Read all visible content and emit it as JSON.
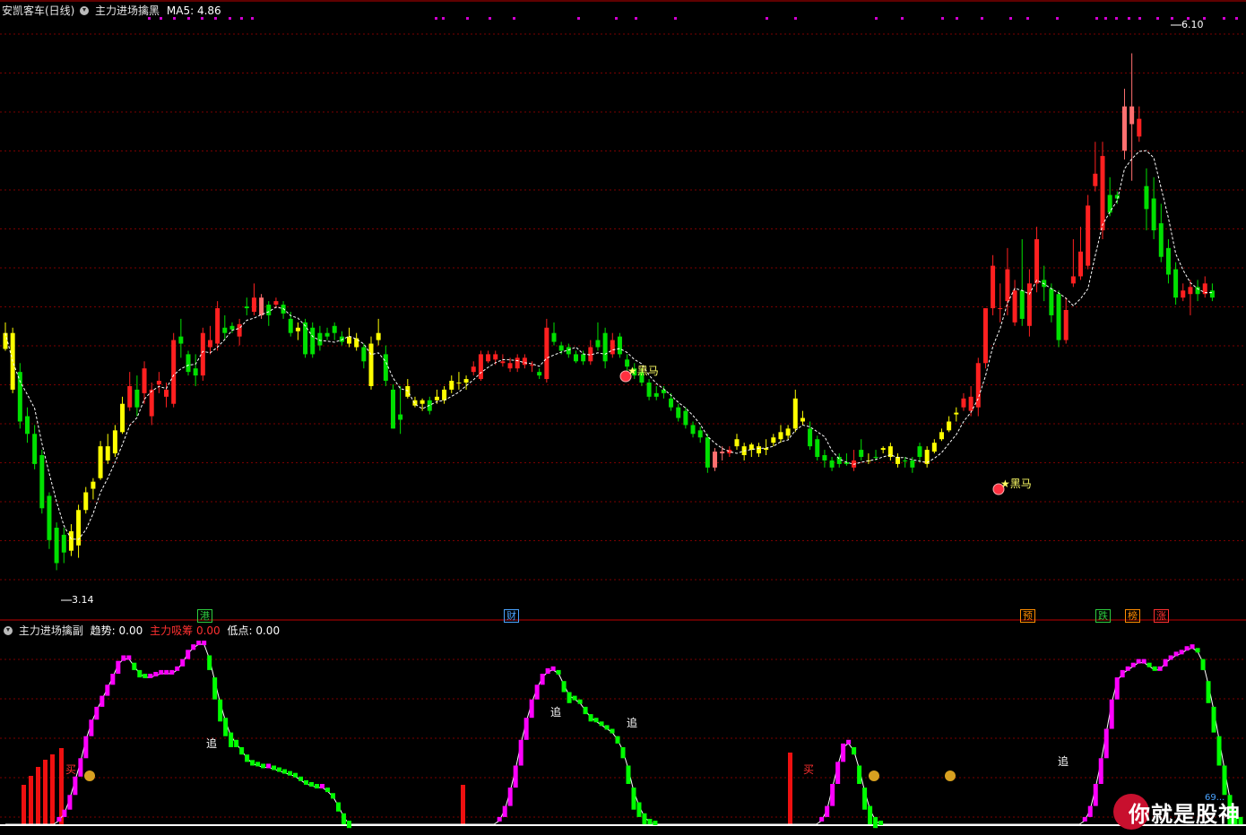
{
  "header": {
    "stock_name": "安凯客车(日线)",
    "indicator_name": "主力进场擒黑",
    "ma_label": "MA5:",
    "ma_value": "4.86"
  },
  "sub_header": {
    "indicator_name": "主力进场擒副",
    "trend_label": "趋势:",
    "trend_value": "0.00",
    "absorb_label": "主力吸筹",
    "absorb_value": "0.00",
    "low_label": "低点:",
    "low_value": "0.00"
  },
  "price_labels": {
    "high": "6.10",
    "low": "3.14"
  },
  "signals": {
    "dark_horse": "黑马",
    "buy": "买",
    "chase": "追"
  },
  "event_tags": [
    {
      "text": "港",
      "color": "#2ecc40"
    },
    {
      "text": "财",
      "color": "#4aa3ff"
    },
    {
      "text": "预",
      "color": "#ff8c00"
    },
    {
      "text": "跌",
      "color": "#2ecc40"
    },
    {
      "text": "榜",
      "color": "#ff8c00"
    },
    {
      "text": "涨",
      "color": "#ff3030"
    }
  ],
  "watermark": {
    "text": "你就是股神",
    "small": "69..."
  },
  "colors": {
    "up": "#ff2020",
    "down": "#00e000",
    "yellow": "#ffff00",
    "ma": "#ffffff",
    "trend_up": "#ff00ff",
    "trend_down": "#00ff00",
    "grid": "#7a0000",
    "axis": "#c00000",
    "dots": "#d000d0"
  },
  "chart_data": {
    "type": "candlestick",
    "ylim": [
      3.0,
      6.3
    ],
    "candles": [
      [
        4.43,
        4.52,
        4.58,
        4.42,
        "y"
      ],
      [
        4.52,
        4.2,
        4.55,
        4.18,
        "y"
      ],
      [
        4.3,
        4.02,
        4.35,
        3.98,
        "d"
      ],
      [
        4.05,
        3.95,
        4.1,
        3.9,
        "d"
      ],
      [
        3.95,
        3.78,
        4.0,
        3.75,
        "d"
      ],
      [
        3.83,
        3.53,
        3.86,
        3.5,
        "d"
      ],
      [
        3.6,
        3.35,
        3.62,
        3.3,
        "d"
      ],
      [
        3.42,
        3.22,
        3.45,
        3.18,
        "d"
      ],
      [
        3.38,
        3.28,
        3.42,
        3.22,
        "d"
      ],
      [
        3.29,
        3.4,
        3.44,
        3.26,
        "y"
      ],
      [
        3.32,
        3.52,
        3.55,
        3.25,
        "y"
      ],
      [
        3.52,
        3.62,
        3.65,
        3.5,
        "y"
      ],
      [
        3.64,
        3.68,
        3.7,
        3.58,
        "y"
      ],
      [
        3.7,
        3.88,
        3.91,
        3.69,
        "y"
      ],
      [
        3.88,
        3.8,
        3.95,
        3.78,
        "y"
      ],
      [
        3.84,
        3.97,
        4.0,
        3.82,
        "y"
      ],
      [
        3.96,
        4.12,
        4.16,
        3.95,
        "y"
      ],
      [
        4.1,
        4.22,
        4.3,
        4.08,
        "u"
      ],
      [
        4.2,
        4.1,
        4.28,
        4.05,
        "d"
      ],
      [
        4.18,
        4.32,
        4.36,
        4.12,
        "u"
      ],
      [
        4.05,
        4.2,
        4.24,
        4.0,
        "u"
      ],
      [
        4.23,
        4.25,
        4.3,
        4.18,
        "u"
      ],
      [
        4.2,
        4.16,
        4.24,
        4.1,
        "u"
      ],
      [
        4.12,
        4.48,
        4.52,
        4.1,
        "u"
      ],
      [
        4.46,
        4.5,
        4.6,
        4.38,
        "d"
      ],
      [
        4.4,
        4.3,
        4.42,
        4.28,
        "d"
      ],
      [
        4.32,
        4.28,
        4.4,
        4.22,
        "d"
      ],
      [
        4.28,
        4.52,
        4.55,
        4.25,
        "u"
      ],
      [
        4.48,
        4.44,
        4.56,
        4.4,
        "u"
      ],
      [
        4.46,
        4.66,
        4.7,
        4.42,
        "u"
      ],
      [
        4.55,
        4.52,
        4.62,
        4.48,
        "d"
      ],
      [
        4.56,
        4.54,
        4.58,
        4.52,
        "d"
      ],
      [
        4.5,
        4.57,
        4.6,
        4.45,
        "u"
      ],
      [
        4.66,
        4.67,
        4.72,
        4.62,
        "d"
      ],
      [
        4.64,
        4.72,
        4.8,
        4.62,
        "u"
      ],
      [
        4.72,
        4.62,
        4.74,
        4.6,
        "r"
      ],
      [
        4.68,
        4.62,
        4.7,
        4.56,
        "d"
      ],
      [
        4.68,
        4.7,
        4.72,
        4.66,
        "u"
      ],
      [
        4.68,
        4.63,
        4.7,
        4.6,
        "d"
      ],
      [
        4.6,
        4.52,
        4.64,
        4.5,
        "d"
      ],
      [
        4.53,
        4.55,
        4.58,
        4.48,
        "y"
      ],
      [
        4.58,
        4.4,
        4.6,
        4.38,
        "d"
      ],
      [
        4.55,
        4.4,
        4.58,
        4.38,
        "d"
      ],
      [
        4.45,
        4.52,
        4.56,
        4.42,
        "d"
      ],
      [
        4.52,
        4.5,
        4.55,
        4.48,
        "d"
      ],
      [
        4.56,
        4.52,
        4.58,
        4.48,
        "d"
      ],
      [
        4.5,
        4.47,
        4.53,
        4.45,
        "d"
      ],
      [
        4.46,
        4.5,
        4.55,
        4.44,
        "y"
      ],
      [
        4.49,
        4.44,
        4.52,
        4.42,
        "y"
      ],
      [
        4.44,
        4.36,
        4.46,
        4.32,
        "d"
      ],
      [
        4.46,
        4.22,
        4.5,
        4.2,
        "y"
      ],
      [
        4.48,
        4.52,
        4.6,
        4.45,
        "y"
      ],
      [
        4.4,
        4.25,
        4.45,
        4.22,
        "d"
      ],
      [
        4.2,
        3.98,
        4.23,
        3.98,
        "d"
      ],
      [
        4.03,
        4.06,
        4.22,
        3.95,
        "d"
      ],
      [
        4.22,
        4.16,
        4.26,
        4.15,
        "y"
      ],
      [
        4.11,
        4.14,
        4.16,
        4.1,
        "y"
      ],
      [
        4.14,
        4.12,
        4.15,
        4.08,
        "y"
      ],
      [
        4.14,
        4.08,
        4.16,
        4.06,
        "d"
      ],
      [
        4.14,
        4.16,
        4.2,
        4.12,
        "y"
      ],
      [
        4.14,
        4.2,
        4.22,
        4.12,
        "y"
      ],
      [
        4.2,
        4.25,
        4.28,
        4.18,
        "y"
      ],
      [
        4.24,
        4.24,
        4.3,
        4.2,
        "y"
      ],
      [
        4.24,
        4.26,
        4.28,
        4.2,
        "y"
      ],
      [
        4.3,
        4.33,
        4.36,
        4.28,
        "u"
      ],
      [
        4.26,
        4.4,
        4.42,
        4.25,
        "u"
      ],
      [
        4.36,
        4.4,
        4.42,
        4.35,
        "u"
      ],
      [
        4.4,
        4.37,
        4.42,
        4.34,
        "u"
      ],
      [
        4.36,
        4.35,
        4.4,
        4.33,
        "u"
      ],
      [
        4.35,
        4.32,
        4.38,
        4.3,
        "u"
      ],
      [
        4.32,
        4.38,
        4.4,
        4.3,
        "u"
      ],
      [
        4.38,
        4.34,
        4.4,
        4.32,
        "u"
      ],
      [
        4.34,
        4.34,
        4.36,
        4.3,
        "u"
      ],
      [
        4.3,
        4.28,
        4.32,
        4.26,
        "d"
      ],
      [
        4.26,
        4.55,
        4.6,
        4.24,
        "u"
      ],
      [
        4.52,
        4.47,
        4.58,
        4.45,
        "d"
      ],
      [
        4.45,
        4.42,
        4.47,
        4.4,
        "d"
      ],
      [
        4.44,
        4.4,
        4.46,
        4.38,
        "d"
      ],
      [
        4.4,
        4.36,
        4.42,
        4.35,
        "d"
      ],
      [
        4.4,
        4.36,
        4.42,
        4.34,
        "d"
      ],
      [
        4.36,
        4.44,
        4.48,
        4.34,
        "u"
      ],
      [
        4.44,
        4.48,
        4.58,
        4.42,
        "d"
      ],
      [
        4.52,
        4.36,
        4.55,
        4.32,
        "d"
      ],
      [
        4.4,
        4.48,
        4.52,
        4.38,
        "u"
      ],
      [
        4.5,
        4.4,
        4.52,
        4.38,
        "d"
      ],
      [
        4.37,
        4.33,
        4.4,
        4.3,
        "d"
      ],
      [
        4.32,
        4.28,
        4.35,
        4.26,
        "d"
      ],
      [
        4.3,
        4.24,
        4.32,
        4.22,
        "d"
      ],
      [
        4.24,
        4.16,
        4.26,
        4.14,
        "d"
      ],
      [
        4.18,
        4.16,
        4.22,
        4.14,
        "d"
      ],
      [
        4.2,
        4.18,
        4.22,
        4.15,
        "d"
      ],
      [
        4.15,
        4.1,
        4.18,
        4.08,
        "d"
      ],
      [
        4.1,
        4.04,
        4.12,
        4.02,
        "d"
      ],
      [
        4.08,
        4.0,
        4.1,
        3.98,
        "d"
      ],
      [
        4.0,
        3.95,
        4.02,
        3.93,
        "d"
      ],
      [
        3.97,
        3.93,
        3.99,
        3.9,
        "d"
      ],
      [
        3.93,
        3.76,
        3.95,
        3.73,
        "d"
      ],
      [
        3.76,
        3.85,
        3.87,
        3.74,
        "r"
      ],
      [
        3.84,
        3.85,
        3.88,
        3.8,
        "r"
      ],
      [
        3.84,
        3.86,
        3.88,
        3.82,
        "u"
      ],
      [
        3.92,
        3.88,
        3.95,
        3.86,
        "y"
      ],
      [
        3.88,
        3.83,
        3.9,
        3.8,
        "y"
      ],
      [
        3.86,
        3.89,
        3.9,
        3.82,
        "y"
      ],
      [
        3.84,
        3.88,
        3.9,
        3.82,
        "y"
      ],
      [
        3.86,
        3.87,
        3.92,
        3.83,
        "y"
      ],
      [
        3.9,
        3.93,
        3.95,
        3.88,
        "y"
      ],
      [
        3.92,
        3.96,
        4.0,
        3.9,
        "y"
      ],
      [
        3.98,
        3.94,
        4.0,
        3.92,
        "y"
      ],
      [
        3.98,
        4.15,
        4.2,
        3.96,
        "y"
      ],
      [
        4.04,
        4.02,
        4.08,
        4.0,
        "y"
      ],
      [
        3.98,
        3.88,
        4.02,
        3.86,
        "d"
      ],
      [
        3.92,
        3.82,
        3.94,
        3.8,
        "d"
      ],
      [
        3.83,
        3.8,
        3.86,
        3.76,
        "d"
      ],
      [
        3.8,
        3.76,
        3.82,
        3.74,
        "d"
      ],
      [
        3.82,
        3.78,
        3.84,
        3.76,
        "d"
      ],
      [
        3.78,
        3.79,
        3.84,
        3.77,
        "d"
      ],
      [
        3.8,
        3.76,
        3.86,
        3.74,
        "u"
      ],
      [
        3.82,
        3.86,
        3.92,
        3.8,
        "d"
      ],
      [
        3.8,
        3.8,
        3.84,
        3.78,
        "y"
      ],
      [
        3.82,
        3.82,
        3.86,
        3.8,
        "d"
      ],
      [
        3.87,
        3.86,
        3.88,
        3.84,
        "y"
      ],
      [
        3.88,
        3.82,
        3.9,
        3.8,
        "y"
      ],
      [
        3.82,
        3.78,
        3.84,
        3.76,
        "y"
      ],
      [
        3.8,
        3.8,
        3.82,
        3.76,
        "d"
      ],
      [
        3.8,
        3.76,
        3.82,
        3.73,
        "d"
      ],
      [
        3.88,
        3.82,
        3.9,
        3.79,
        "d"
      ],
      [
        3.86,
        3.78,
        3.88,
        3.76,
        "y"
      ],
      [
        3.85,
        3.9,
        3.92,
        3.84,
        "y"
      ],
      [
        3.92,
        3.96,
        3.98,
        3.91,
        "y"
      ],
      [
        3.97,
        4.02,
        4.05,
        3.96,
        "y"
      ],
      [
        4.06,
        4.07,
        4.1,
        4.02,
        "y"
      ],
      [
        4.1,
        4.15,
        4.18,
        4.08,
        "u"
      ],
      [
        4.08,
        4.16,
        4.22,
        4.05,
        "u"
      ],
      [
        4.1,
        4.35,
        4.38,
        4.05,
        "u"
      ],
      [
        4.35,
        4.66,
        4.66,
        4.32,
        "u"
      ],
      [
        4.66,
        4.9,
        4.96,
        4.62,
        "u"
      ],
      [
        4.66,
        4.66,
        4.8,
        4.58,
        "u"
      ],
      [
        4.7,
        4.88,
        5.0,
        4.62,
        "u"
      ],
      [
        4.58,
        4.76,
        4.82,
        4.56,
        "u"
      ],
      [
        4.76,
        4.6,
        5.05,
        4.56,
        "d"
      ],
      [
        4.56,
        4.8,
        4.88,
        4.5,
        "u"
      ],
      [
        4.8,
        5.05,
        5.12,
        4.75,
        "u"
      ],
      [
        4.82,
        4.78,
        4.9,
        4.7,
        "d"
      ],
      [
        4.77,
        4.62,
        4.8,
        4.58,
        "d"
      ],
      [
        4.74,
        4.48,
        4.76,
        4.44,
        "d"
      ],
      [
        4.48,
        4.65,
        4.72,
        4.46,
        "u"
      ],
      [
        4.8,
        4.84,
        5.05,
        4.78,
        "u"
      ],
      [
        4.84,
        4.98,
        5.12,
        4.82,
        "u"
      ],
      [
        5.24,
        4.9,
        5.3,
        4.88,
        "u"
      ],
      [
        5.35,
        5.42,
        5.6,
        5.32,
        "u"
      ],
      [
        5.1,
        5.52,
        5.6,
        5.05,
        "u"
      ],
      [
        5.3,
        5.2,
        5.4,
        5.18,
        "d"
      ],
      [
        5.28,
        5.3,
        5.32,
        5.25,
        "d"
      ],
      [
        5.55,
        5.8,
        5.9,
        5.5,
        "r"
      ],
      [
        5.8,
        5.7,
        6.1,
        5.38,
        "r"
      ],
      [
        5.63,
        5.73,
        5.8,
        5.6,
        "u"
      ],
      [
        5.35,
        5.22,
        5.45,
        5.1,
        "d"
      ],
      [
        5.28,
        5.1,
        5.4,
        5.05,
        "d"
      ],
      [
        5.14,
        4.95,
        5.25,
        4.92,
        "d"
      ],
      [
        5.0,
        4.85,
        5.05,
        4.8,
        "d"
      ],
      [
        4.88,
        4.72,
        4.92,
        4.68,
        "d"
      ],
      [
        4.72,
        4.76,
        4.8,
        4.7,
        "u"
      ],
      [
        4.78,
        4.74,
        4.82,
        4.62,
        "u"
      ],
      [
        4.74,
        4.78,
        4.82,
        4.7,
        "d"
      ],
      [
        4.8,
        4.74,
        4.84,
        4.72,
        "u"
      ],
      [
        4.76,
        4.72,
        4.8,
        4.7,
        "d"
      ]
    ],
    "sub_series": [
      0,
      0,
      0,
      0,
      0,
      0,
      0,
      0,
      0,
      0,
      2,
      6,
      14,
      24,
      34,
      46,
      55,
      62,
      68,
      74,
      80,
      87,
      90,
      90,
      86,
      82,
      80,
      80,
      81,
      82,
      82,
      82,
      84,
      88,
      93,
      96,
      98,
      98,
      90,
      78,
      66,
      56,
      48,
      44,
      40,
      36,
      33,
      32,
      31,
      31,
      30,
      29,
      28,
      27,
      26,
      24,
      22,
      21,
      20,
      20,
      18,
      15,
      10,
      4,
      0,
      0,
      0,
      0,
      0,
      0,
      0,
      0,
      0,
      0,
      0,
      0,
      0,
      0,
      0,
      0,
      0,
      0,
      0,
      0,
      0,
      0,
      0,
      0,
      0,
      0,
      0,
      0,
      2,
      8,
      18,
      30,
      44,
      56,
      66,
      74,
      80,
      83,
      84,
      82,
      76,
      70,
      68,
      66,
      62,
      58,
      56,
      54,
      52,
      50,
      46,
      40,
      30,
      18,
      10,
      4,
      1,
      0,
      0,
      0,
      0,
      0,
      0,
      0,
      0,
      0,
      0,
      0,
      0,
      0,
      0,
      0,
      0,
      0,
      0,
      0,
      0,
      0,
      0,
      0,
      0,
      0,
      0,
      0,
      0,
      0,
      0,
      0,
      2,
      8,
      20,
      32,
      42,
      44,
      40,
      30,
      18,
      8,
      2,
      0,
      0,
      0,
      0,
      0,
      0,
      0,
      0,
      0,
      0,
      0,
      0,
      0,
      0,
      0,
      0,
      0,
      0,
      0,
      0,
      0,
      0,
      0,
      0,
      0,
      0,
      0,
      0,
      0,
      0,
      0,
      0,
      0,
      0,
      0,
      0,
      0,
      0,
      2,
      8,
      20,
      34,
      50,
      66,
      78,
      82,
      84,
      86,
      88,
      88,
      86,
      84,
      84,
      88,
      90,
      92,
      93,
      95,
      96,
      94,
      88,
      76,
      62,
      46,
      30,
      14,
      6,
      2
    ],
    "xlabel": "",
    "ylabel": ""
  }
}
